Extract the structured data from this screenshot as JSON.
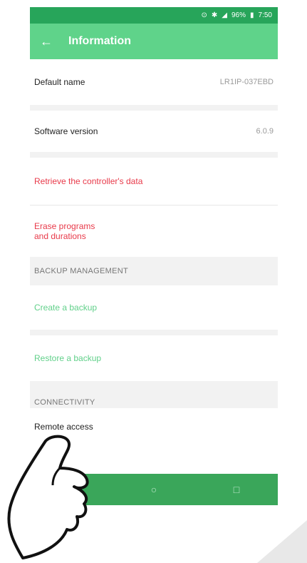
{
  "status_bar": {
    "icons": [
      "alarm-icon",
      "bluetooth-icon",
      "signal-icon"
    ],
    "battery": "96%",
    "time": "7:50"
  },
  "app_bar": {
    "back_icon": "arrow-left-icon",
    "title": "Information"
  },
  "rows": {
    "default_name": {
      "label": "Default name",
      "value": "LR1IP-037EBD"
    },
    "software_version": {
      "label": "Software version",
      "value": "6.0.9"
    },
    "retrieve": {
      "label": "Retrieve the controller's data"
    },
    "erase": {
      "line1": "Erase programs",
      "line2": "and durations"
    }
  },
  "backup_management": {
    "header": "BACKUP MANAGEMENT",
    "create": "Create a backup",
    "restore": "Restore a backup"
  },
  "connectivity": {
    "header": "CONNECTIVITY",
    "remote_access": "Remote access"
  },
  "nav_bar": {
    "back": "◁",
    "home": "○",
    "recents": "□"
  },
  "colors": {
    "status_bar": "#27a55a",
    "app_bar": "#5fd38a",
    "danger_text": "#e83a4a",
    "accent_text": "#61d08a",
    "nav_bar": "#3aa65a"
  }
}
